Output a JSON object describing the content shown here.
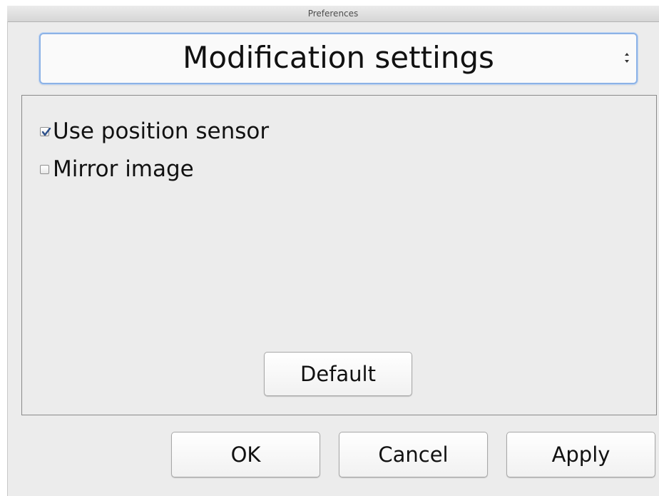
{
  "window": {
    "title": "Preferences"
  },
  "category_select": {
    "selected": "Modification settings"
  },
  "options": [
    {
      "label": "Use position sensor",
      "checked": true
    },
    {
      "label": "Mirror image",
      "checked": false
    }
  ],
  "panel": {
    "default_label": "Default"
  },
  "footer": {
    "ok_label": "OK",
    "cancel_label": "Cancel",
    "apply_label": "Apply"
  },
  "colors": {
    "window_background": "#ececec",
    "focus_ring": "#8cb2e6",
    "checkmark": "#2b4f8a"
  }
}
